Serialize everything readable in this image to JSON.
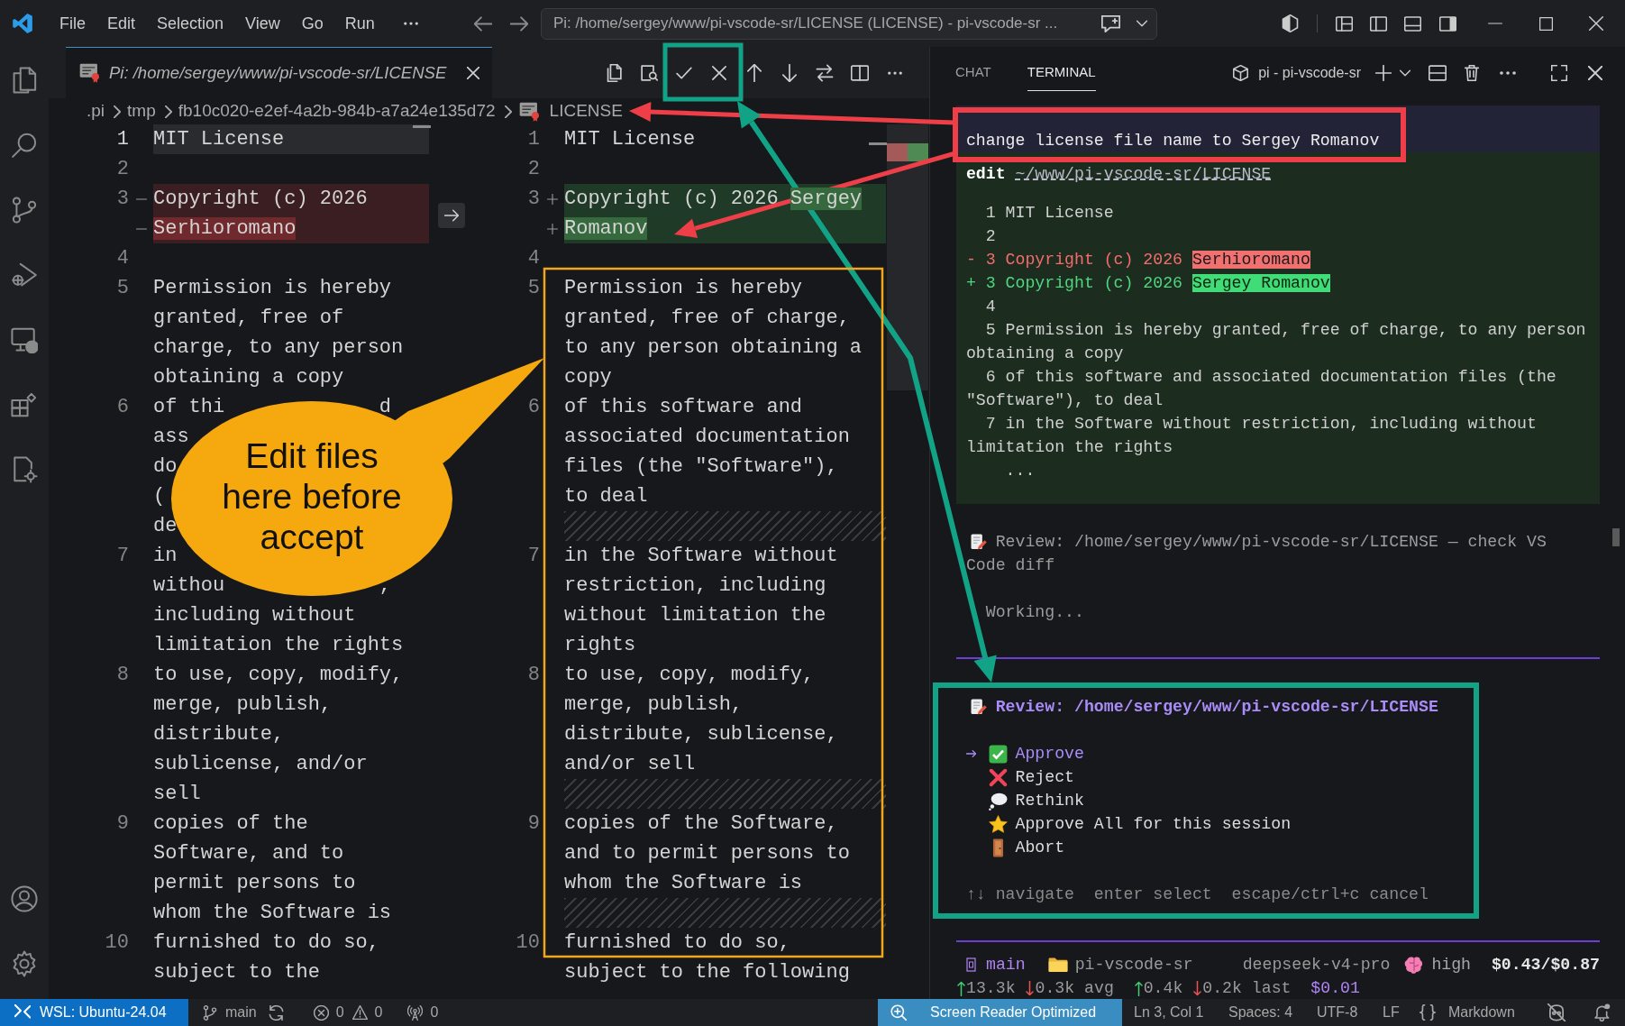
{
  "title_bar": {
    "menu": [
      "File",
      "Edit",
      "Selection",
      "View",
      "Go",
      "Run"
    ],
    "command_center": "Pi: /home/sergey/www/pi-vscode-sr/LICENSE (LICENSE) - pi-vscode-sr ..."
  },
  "editor": {
    "tabs": [
      {
        "label": "Pi: /home/sergey/www/pi-vscode-sr/LICENSE",
        "selected": true,
        "preview": true
      }
    ],
    "breadcrumb": [
      ".pi",
      "tmp",
      "fb10c020-e2ef-4a2b-984b-a7a24e135d72",
      "LICENSE"
    ],
    "original": {
      "lines": [
        {
          "number": "1",
          "kind": "unchanged",
          "highlighted": true,
          "rows": [
            "MIT License"
          ]
        },
        {
          "number": "2",
          "kind": "unchanged",
          "highlighted": false
        },
        {
          "number": "3",
          "kind": "removed",
          "highlighted": false,
          "rows": [
            "Copyright (c) 2026",
            {
              "highlight": "Serhioromano"
            }
          ]
        },
        {
          "number": "4",
          "kind": "unchanged",
          "highlighted": false
        },
        {
          "number": "5",
          "kind": "unchanged",
          "highlighted": false,
          "rows": [
            "Permission is hereby",
            "granted, free of",
            "charge, to any person",
            "obtaining a copy"
          ]
        },
        {
          "number": "6",
          "kind": "unchanged",
          "highlighted": false,
          "rows": [
            {
              "text": "of thi",
              "tail": "d"
            },
            "ass",
            "do",
            "(",
            "de"
          ]
        },
        {
          "number": "7",
          "kind": "unchanged",
          "highlighted": false,
          "rows": [
            "in",
            {
              "text": "withou",
              "tail": ","
            },
            "including without",
            "limitation the rights"
          ]
        },
        {
          "number": "8",
          "kind": "unchanged",
          "highlighted": false,
          "rows": [
            "to use, copy, modify,",
            "merge, publish,",
            "distribute,",
            "sublicense, and/or",
            "sell"
          ]
        },
        {
          "number": "9",
          "kind": "unchanged",
          "highlighted": false,
          "rows": [
            "copies of the",
            "Software, and to",
            "permit persons to",
            "whom the Software is"
          ]
        },
        {
          "number": "10",
          "kind": "unchanged",
          "highlighted": false,
          "rows": [
            "furnished to do so,",
            "subject to the"
          ]
        }
      ]
    },
    "modified": {
      "lines": [
        {
          "kind": "unchanged",
          "number": "1",
          "rows": [
            "MIT License"
          ]
        },
        {
          "kind": "unchanged",
          "number": "2"
        },
        {
          "kind": "added",
          "number": "3",
          "rows": [
            {
              "text": "Copyright (c) 2026 ",
              "highlight": "Sergey"
            },
            {
              "highlight": "Romanov"
            }
          ]
        },
        {
          "kind": "unchanged",
          "number": "4"
        },
        {
          "kind": "unchanged",
          "number": "5",
          "rows": [
            "Permission is hereby",
            "granted, free of charge,",
            "to any person obtaining a",
            "copy"
          ]
        },
        {
          "kind": "unchanged",
          "number": "6",
          "rows": [
            "of this software and",
            "associated documentation",
            "files (the \"Software\"),",
            "to deal"
          ]
        },
        {
          "kind": "filler"
        },
        {
          "kind": "unchanged",
          "number": "7",
          "rows": [
            "in the Software without",
            "restriction, including",
            "without limitation the",
            "rights"
          ]
        },
        {
          "kind": "unchanged",
          "number": "8",
          "rows": [
            "to use, copy, modify,",
            "merge, publish,",
            "distribute, sublicense,",
            "and/or sell"
          ]
        },
        {
          "kind": "filler"
        },
        {
          "kind": "unchanged",
          "number": "9",
          "rows": [
            "copies of the Software,",
            "and to permit persons to",
            "whom the Software is"
          ]
        },
        {
          "kind": "filler"
        },
        {
          "kind": "unchanged",
          "number": "10",
          "rows": [
            "furnished to do so,",
            "subject to the following"
          ]
        }
      ]
    }
  },
  "panel": {
    "tabs": [
      {
        "label": "CHAT",
        "selected": false
      },
      {
        "label": "TERMINAL",
        "selected": true
      }
    ],
    "terminal_name": "pi - pi-vscode-sr",
    "terminal": {
      "prompt": "change license file name to Sergey Romanov",
      "tool": {
        "label": "edit",
        "path": "~/www/pi-vscode-sr/LICENSE"
      },
      "diff": [
        {
          "kind": "context",
          "text": "  1 MIT License"
        },
        {
          "kind": "context",
          "text": "  2"
        },
        {
          "kind": "removed",
          "text": "- 3 Copyright (c) 2026 ",
          "highlight": "Serhioromano"
        },
        {
          "kind": "added",
          "text": "+ 3 Copyright (c) 2026 ",
          "highlight": "Sergey Romanov"
        },
        {
          "kind": "context",
          "text": "  4"
        },
        {
          "kind": "context",
          "text": "  5 Permission is hereby granted, free of charge, to any person obtaining a copy"
        },
        {
          "kind": "context",
          "text": "  6 of this software and associated documentation files (the \"Software\"), to deal"
        },
        {
          "kind": "context",
          "text": "  7 in the Software without restriction, including without limitation the rights"
        },
        {
          "kind": "context",
          "text": "    ..."
        }
      ],
      "status_rows": [
        "Review: /home/sergey/www/pi-vscode-sr/LICENSE — check VS",
        "Code diff"
      ],
      "working": "Working...",
      "review": {
        "title": "Review: /home/sergey/www/pi-vscode-sr/LICENSE",
        "options": [
          {
            "kind": "approve",
            "label": "Approve",
            "selected": true
          },
          {
            "kind": "reject",
            "label": "Reject",
            "selected": false
          },
          {
            "kind": "rethink",
            "label": "Rethink",
            "selected": false
          },
          {
            "kind": "approve_all",
            "label": "Approve All for this session",
            "selected": false
          },
          {
            "kind": "abort",
            "label": "Abort",
            "selected": false
          }
        ],
        "hint": "↑↓ navigate  enter select  escape/ctrl+c cancel"
      },
      "footer": {
        "branch": "main",
        "folder": "pi-vscode-sr",
        "model": "deepseek-v4-pro",
        "thinking": "high",
        "cost": "$0.43/$0.87",
        "usage": [
          {
            "kind": "up",
            "text": "13.3k"
          },
          {
            "kind": "down",
            "text": "0.3k"
          },
          {
            "kind": "label",
            "text": "avg"
          },
          {
            "kind": "up",
            "text": "0.4k"
          },
          {
            "kind": "down",
            "text": "0.2k"
          },
          {
            "kind": "label",
            "text": "last"
          },
          {
            "kind": "cost",
            "text": "$0.01"
          }
        ]
      }
    }
  },
  "status_bar": {
    "remote": "WSL: Ubuntu-24.04",
    "branch": "main",
    "errors": "0",
    "warnings": "0",
    "ports": "0",
    "screen_reader": "Screen Reader Optimized",
    "cursor": "Ln 3, Col 1",
    "indentation": "Spaces: 4",
    "encoding": "UTF-8",
    "eol": "LF",
    "language": "Markdown"
  },
  "callout": {
    "text": "Edit files here before accept"
  }
}
